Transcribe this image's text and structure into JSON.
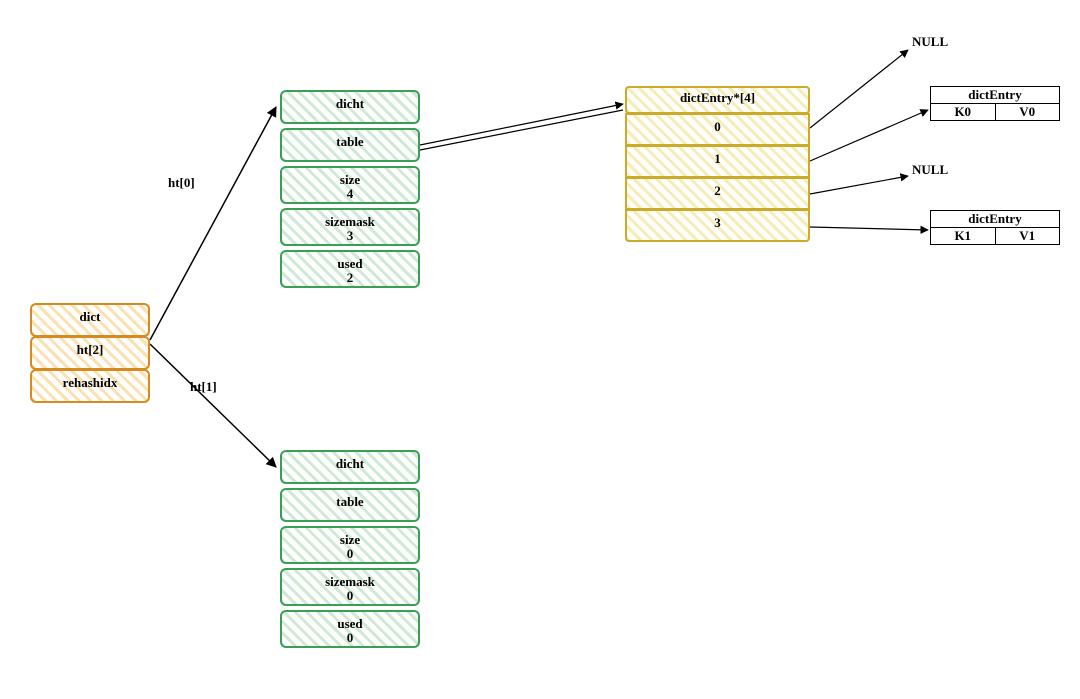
{
  "dict": {
    "title": "dict",
    "ht_label": "ht[2]",
    "rehashidx_label": "rehashidx"
  },
  "arrow_labels": {
    "ht0": "ht[0]",
    "ht1": "ht[1]"
  },
  "ht0": {
    "dicht": "dicht",
    "table": "table",
    "size_label": "size",
    "size_value": "4",
    "sizemask_label": "sizemask",
    "sizemask_value": "3",
    "used_label": "used",
    "used_value": "2"
  },
  "ht1": {
    "dicht": "dicht",
    "table": "table",
    "size_label": "size",
    "size_value": "0",
    "sizemask_label": "sizemask",
    "sizemask_value": "0",
    "used_label": "used",
    "used_value": "0"
  },
  "bucket": {
    "header": "dictEntry*[4]",
    "slots": [
      "0",
      "1",
      "2",
      "3"
    ]
  },
  "nulls": {
    "n0": "NULL",
    "n1": "NULL"
  },
  "entry0": {
    "title": "dictEntry",
    "k": "K0",
    "v": "V0"
  },
  "entry1": {
    "title": "dictEntry",
    "k": "K1",
    "v": "V1"
  }
}
